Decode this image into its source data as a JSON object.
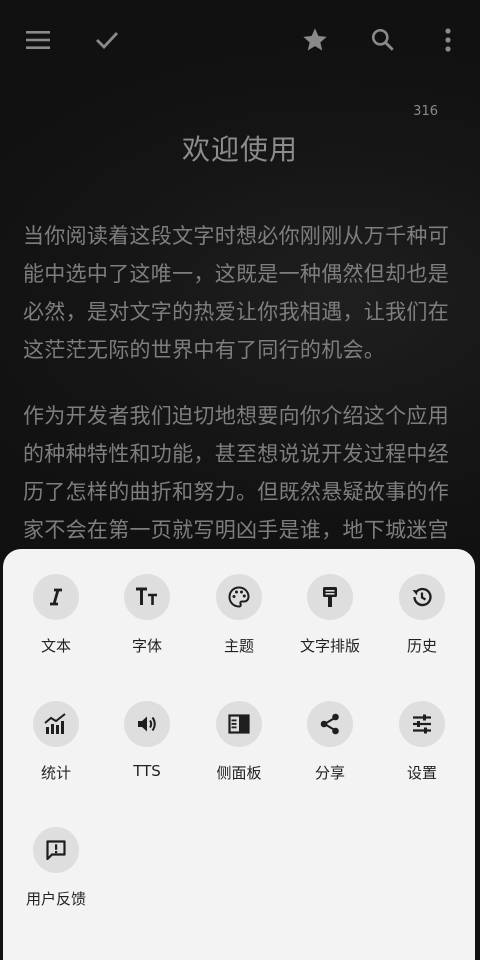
{
  "topbar": {
    "menu_icon": "menu-icon",
    "check_icon": "check-icon",
    "star_icon": "star-icon",
    "search_icon": "search-icon",
    "more_icon": "more-vert-icon"
  },
  "reader": {
    "page_number": "316",
    "chapter_title": "欢迎使用",
    "paragraphs": [
      "当你阅读着这段文字时想必你刚刚从万千种可能中选中了这唯一，这既是一种偶然但却也是必然，是对文字的热爱让你我相遇，让我们在这茫茫无际的世界中有了同行的机会。",
      "作为开发者我们迫切地想要向你介绍这个应用的种种特性和功能，甚至想说说开发过程中经历了怎样的曲折和努力。但既然悬疑故事的作家不会在第一页就写明凶手是谁，地下城迷宫"
    ]
  },
  "menu": {
    "items": [
      {
        "label": "文本",
        "icon": "italic-text-icon"
      },
      {
        "label": "字体",
        "icon": "font-size-icon"
      },
      {
        "label": "主题",
        "icon": "palette-icon"
      },
      {
        "label": "文字排版",
        "icon": "format-paint-icon"
      },
      {
        "label": "历史",
        "icon": "history-icon"
      },
      {
        "label": "统计",
        "icon": "stats-chart-icon"
      },
      {
        "label": "TTS",
        "icon": "volume-icon"
      },
      {
        "label": "侧面板",
        "icon": "side-panel-icon"
      },
      {
        "label": "分享",
        "icon": "share-icon"
      },
      {
        "label": "设置",
        "icon": "tune-icon"
      },
      {
        "label": "用户反馈",
        "icon": "feedback-icon"
      }
    ]
  },
  "colors": {
    "reader_bg": "#141414",
    "reader_text": "#7e7e7e",
    "sheet_bg": "#f3f3f3",
    "icon_circle": "#dedede"
  }
}
